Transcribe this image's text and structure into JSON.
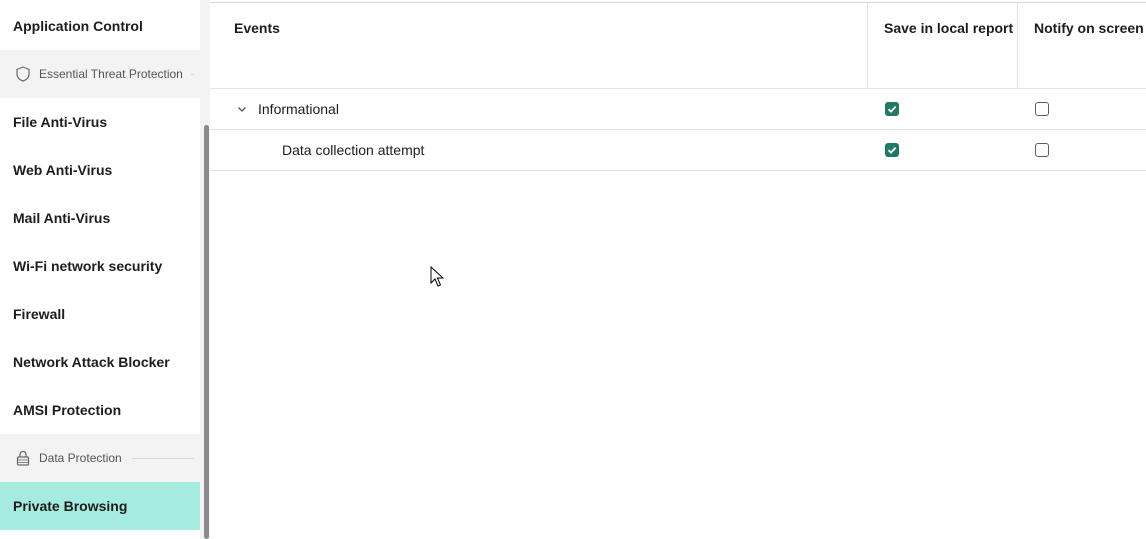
{
  "sidebar": {
    "items_top": [
      {
        "label": "Application Control"
      }
    ],
    "section1": {
      "label": "Essential Threat Protection",
      "icon": "shield-icon"
    },
    "items_mid": [
      {
        "label": "File Anti-Virus"
      },
      {
        "label": "Web Anti-Virus"
      },
      {
        "label": "Mail Anti-Virus"
      },
      {
        "label": "Wi-Fi network security"
      },
      {
        "label": "Firewall"
      },
      {
        "label": "Network Attack Blocker"
      },
      {
        "label": "AMSI Protection"
      }
    ],
    "section2": {
      "label": "Data Protection",
      "icon": "lock-icon"
    },
    "items_bottom": [
      {
        "label": "Private Browsing",
        "active": true
      }
    ]
  },
  "table": {
    "columns": [
      "Events",
      "Save in local report",
      "Notify on screen"
    ],
    "rows": [
      {
        "label": "Informational",
        "expandable": true,
        "expanded": true,
        "save_in_local_report": true,
        "notify_on_screen": false
      },
      {
        "label": "Data collection attempt",
        "expandable": false,
        "save_in_local_report": true,
        "notify_on_screen": false
      }
    ]
  },
  "colors": {
    "accent": "#1f7a66",
    "active_item": "#a6ebdf"
  }
}
